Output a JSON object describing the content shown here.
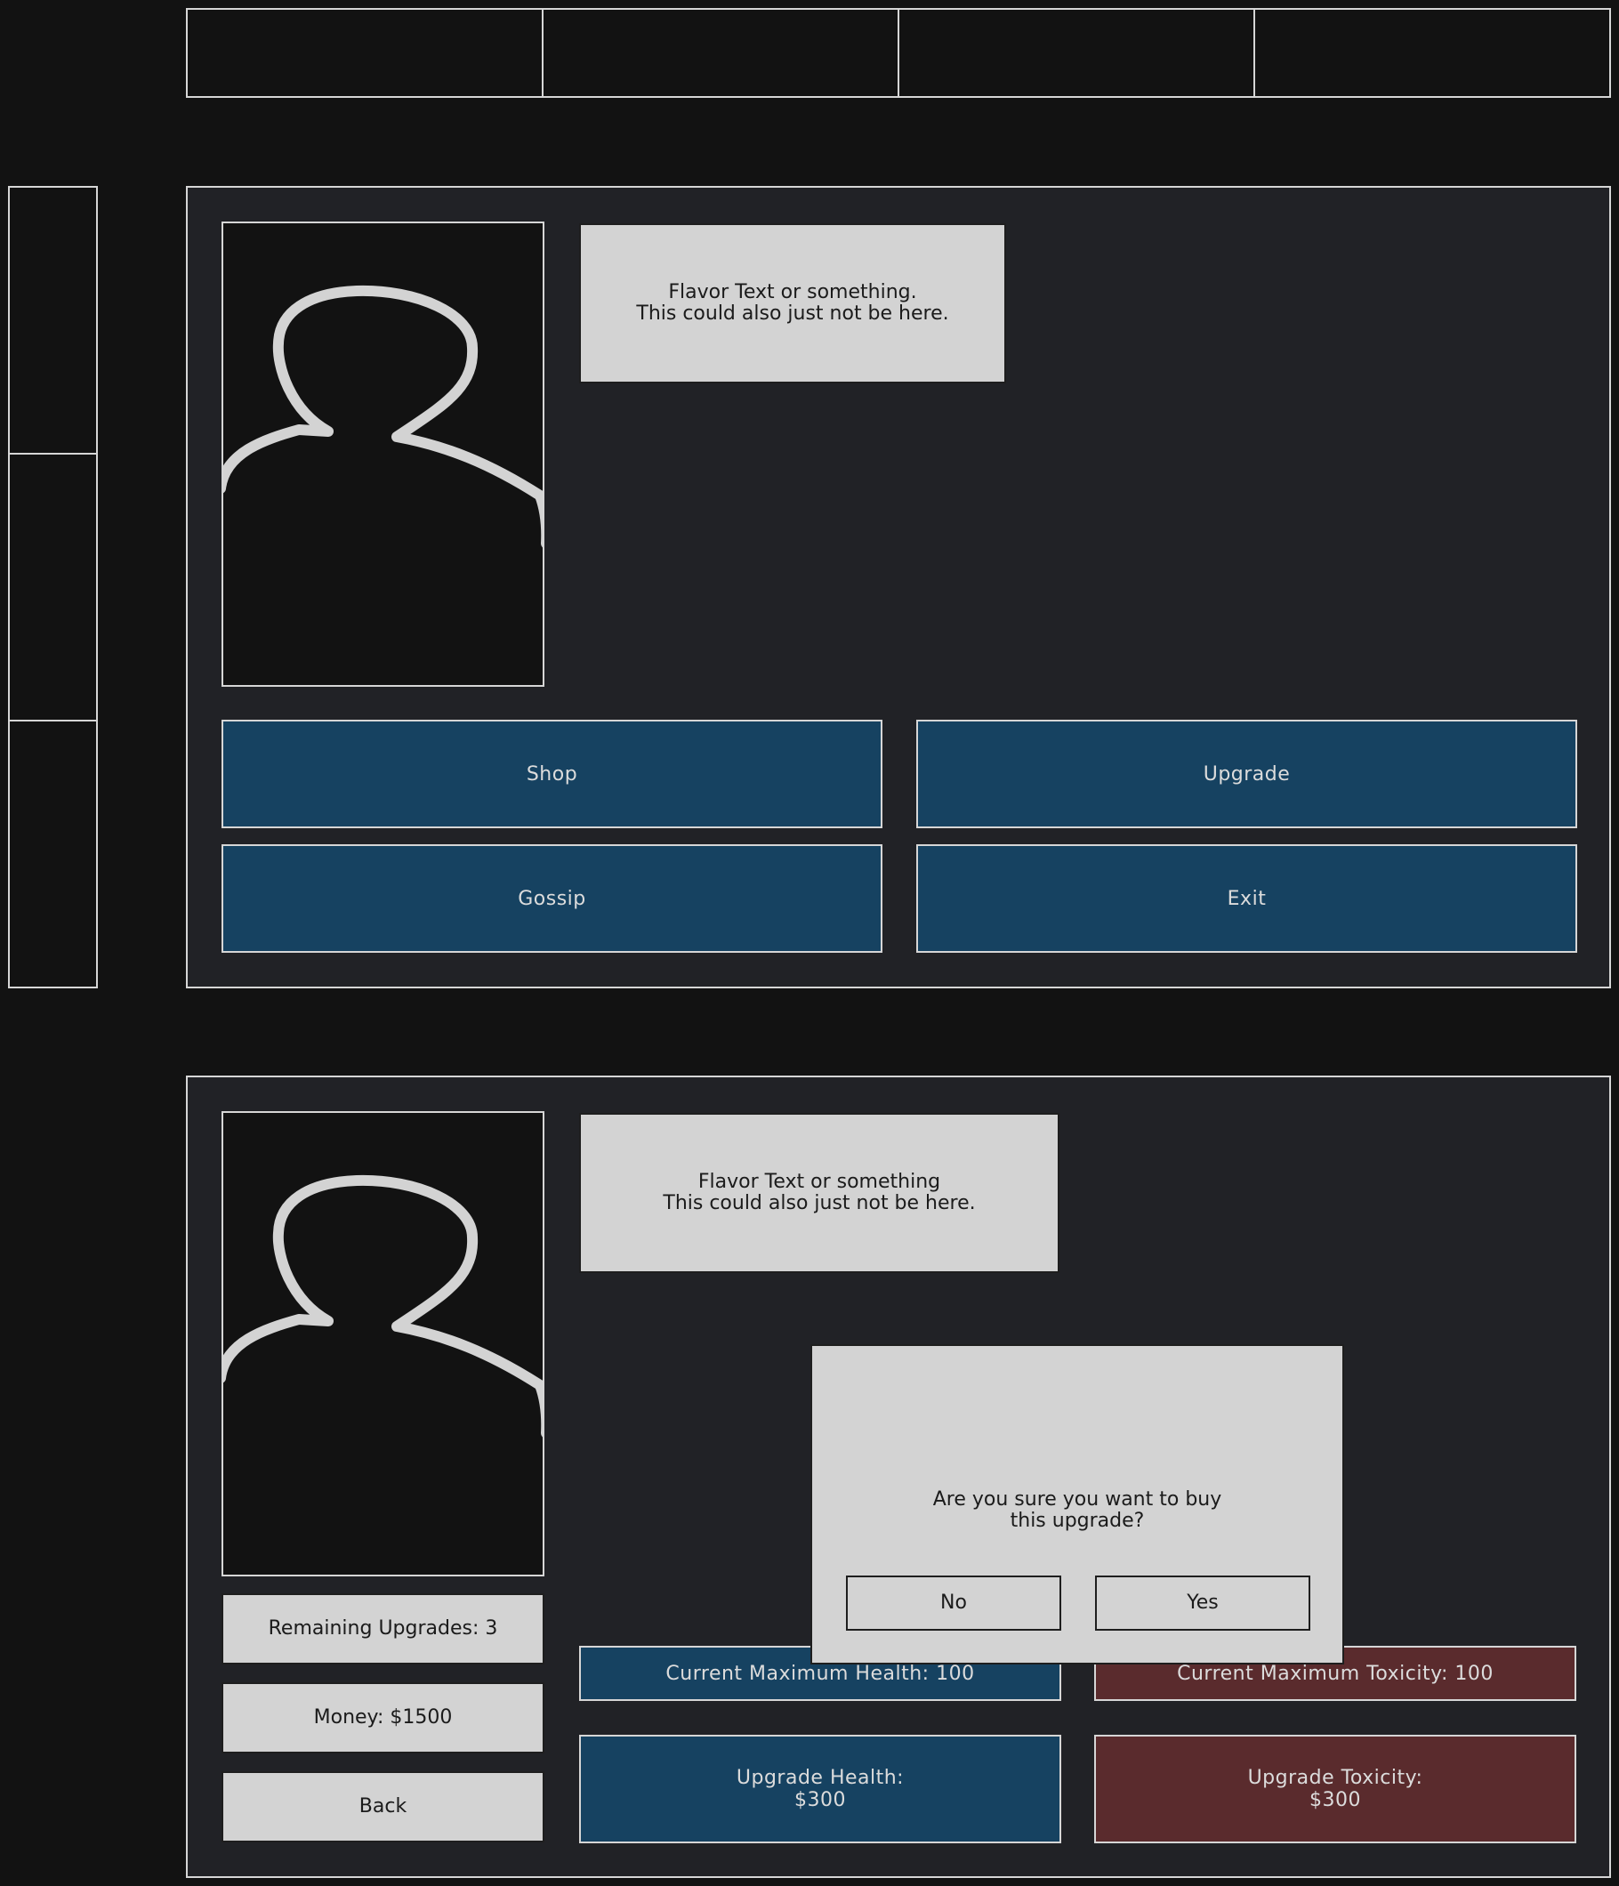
{
  "colors": {
    "background": "#121212",
    "panel": "#212226",
    "outline": "#d6d6d6",
    "light_box": "#d3d3d3",
    "blue": "#164261",
    "red": "#5a2b2d",
    "text_dark": "#1b1b1b",
    "text_light": "#dcdcdc"
  },
  "top_tabs": [
    "",
    "",
    "",
    ""
  ],
  "side_slots": [
    "",
    "",
    ""
  ],
  "screen1": {
    "portrait_icon": "person-silhouette-icon",
    "flavor_text": "Flavor Text or something.\nThis could also just not be here.",
    "buttons": {
      "shop": "Shop",
      "upgrade": "Upgrade",
      "gossip": "Gossip",
      "exit": "Exit"
    }
  },
  "screen2": {
    "portrait_icon": "person-silhouette-icon",
    "flavor_text": "Flavor Text or something\nThis could also just not be here.",
    "info": {
      "remaining_upgrades": "Remaining Upgrades: 3",
      "money": "Money: $1500",
      "back": "Back"
    },
    "stats": {
      "health": "Current Maximum Health: 100",
      "toxicity": "Current Maximum Toxicity: 100"
    },
    "upgrades": {
      "health": "Upgrade Health:\n$300",
      "toxicity": "Upgrade Toxicity:\n$300"
    },
    "confirm_dialog": {
      "message": "Are you sure you want to buy\nthis upgrade?",
      "no": "No",
      "yes": "Yes"
    }
  }
}
